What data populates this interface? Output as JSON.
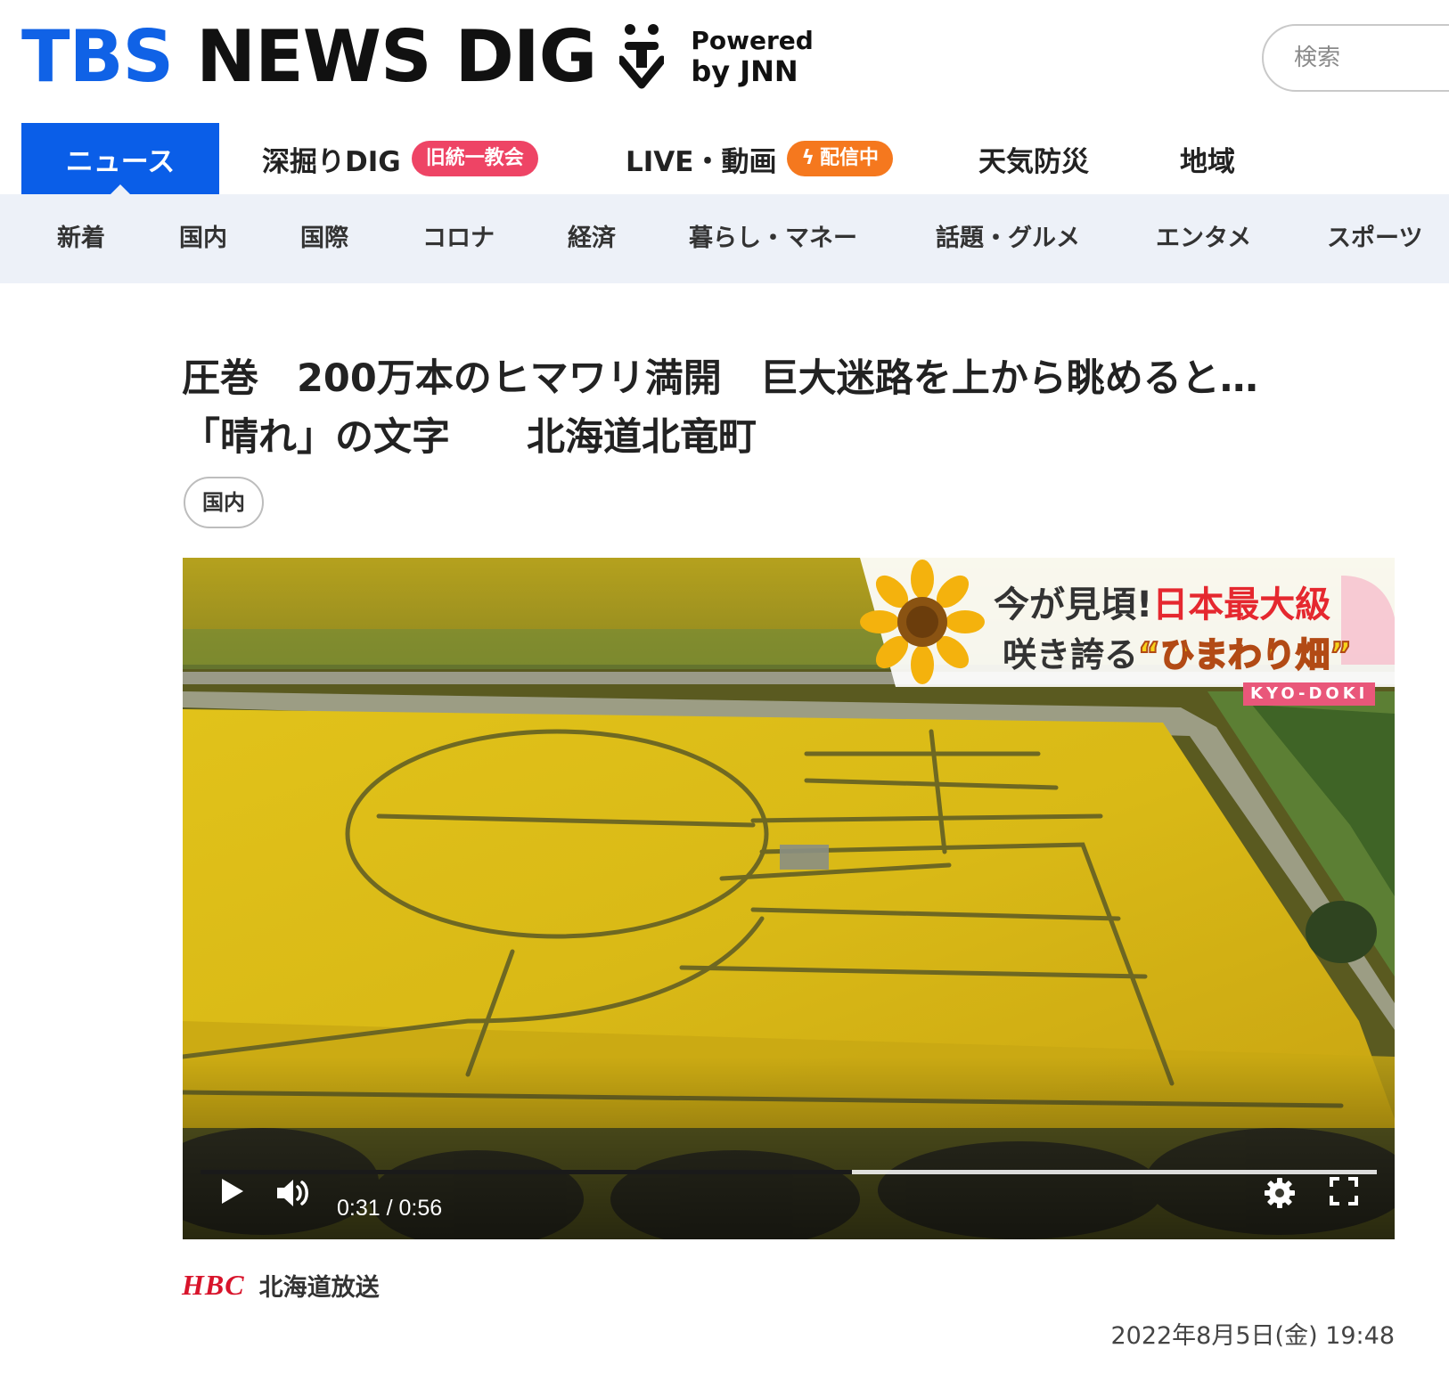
{
  "header": {
    "logo_tbs": "TBS",
    "logo_news": "NEWS DIG",
    "logo_powered": "Powered",
    "logo_by": "by JNN",
    "search_placeholder": "検索"
  },
  "main_nav": {
    "items": [
      {
        "label": "ニュース",
        "active": true
      },
      {
        "label": "深掘りDIG",
        "badge": "旧統一教会"
      },
      {
        "label": "LIVE・動画",
        "badge": "配信中"
      },
      {
        "label": "天気防災"
      },
      {
        "label": "地域"
      }
    ]
  },
  "sub_nav": {
    "items": [
      "新着",
      "国内",
      "国際",
      "コロナ",
      "経済",
      "暮らし・マネー",
      "話題・グルメ",
      "エンタメ",
      "スポーツ"
    ]
  },
  "article": {
    "title_line1": "圧巻　200万本のヒマワリ満開　巨大迷路を上から眺めると…",
    "title_line2": "「晴れ」の文字　　北海道北竜町",
    "category": "国内",
    "source_logo": "HBC",
    "source_name": "北海道放送",
    "published": "2022年8月5日(金) 19:48"
  },
  "video": {
    "overlay_line1_a": "今が見頃!",
    "overlay_line1_b": "日本最大級",
    "overlay_line2_a": "咲き誇る",
    "overlay_line2_b": "“ひまわり畑”",
    "overlay_tag": "KYO-DOKI",
    "current_time": "0:31",
    "duration": "0:56",
    "time_display": "0:31 / 0:56",
    "progress": 0.554,
    "icons": {
      "play": "play-icon",
      "volume": "volume-icon",
      "settings": "gear-icon",
      "fullscreen": "fullscreen-icon"
    }
  },
  "colors": {
    "brand_blue": "#1062e6",
    "nav_active": "#0a5ee8",
    "badge_red": "#ee4465",
    "badge_orange": "#f5781e",
    "subnav_bg": "#edf1f8",
    "hbc_red": "#d8142b"
  }
}
